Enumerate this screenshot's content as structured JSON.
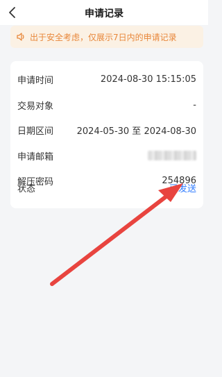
{
  "header": {
    "title": "申请记录",
    "back_icon": "chevron-left-icon"
  },
  "notice": {
    "icon": "speaker-icon",
    "text": "出于安全考虑，仅展示7日内的申请记录",
    "color": "#e8873a",
    "background": "#fbf1e4"
  },
  "record": {
    "rows": [
      {
        "label": "申请时间",
        "value": "2024-08-30 15:15:05"
      },
      {
        "label": "交易对象",
        "value": "-"
      },
      {
        "label": "日期区间",
        "value": "2024-05-30 至 2024-08-30"
      },
      {
        "label": "申请邮箱",
        "value": ""
      },
      {
        "label": "解压密码",
        "value": "254896"
      },
      {
        "label": "状态",
        "value": "已发送"
      }
    ]
  },
  "annotation": {
    "arrow_color": "#e8443f"
  },
  "colors": {
    "accent_blue": "#2f7bff",
    "page_background": "#f4f5f7"
  }
}
